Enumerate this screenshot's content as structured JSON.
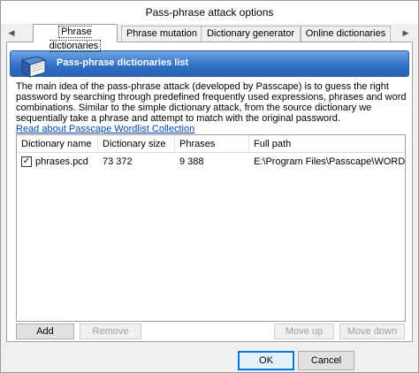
{
  "window": {
    "title": "Pass-phrase attack options"
  },
  "tabs": [
    {
      "label": "Phrase dictionaries",
      "active": true
    },
    {
      "label": "Phrase mutation",
      "active": false
    },
    {
      "label": "Dictionary generator",
      "active": false
    },
    {
      "label": "Online dictionaries",
      "active": false
    }
  ],
  "tab_scroll": {
    "left": "◀",
    "right": "▶"
  },
  "banner": {
    "title": "Pass-phrase dictionaries list",
    "icon": "book-icon",
    "color": "#2f6fc5"
  },
  "description": "The main idea of the pass-phrase attack (developed by Passcape) is to guess the right password by searching through predefined frequently used expressions, phrases and word combinations. Similar to the simple dictionary attack, from the source dictionary we sequentially take a phrase and attempt to match with the original password.",
  "link": "Read about Passcape Wordlist Collection",
  "list": {
    "columns": [
      "Dictionary name",
      "Dictionary size",
      "Phrases",
      "Full path"
    ],
    "rows": [
      {
        "checked": true,
        "name": "phrases.pcd",
        "size": "73 372",
        "phrases": "9 388",
        "path": "E:\\Program Files\\Passcape\\WORDPR..."
      }
    ]
  },
  "list_buttons": {
    "add": "Add",
    "remove": "Remove",
    "move_up": "Move up",
    "move_down": "Move down"
  },
  "footer": {
    "ok": "OK",
    "cancel": "Cancel"
  }
}
